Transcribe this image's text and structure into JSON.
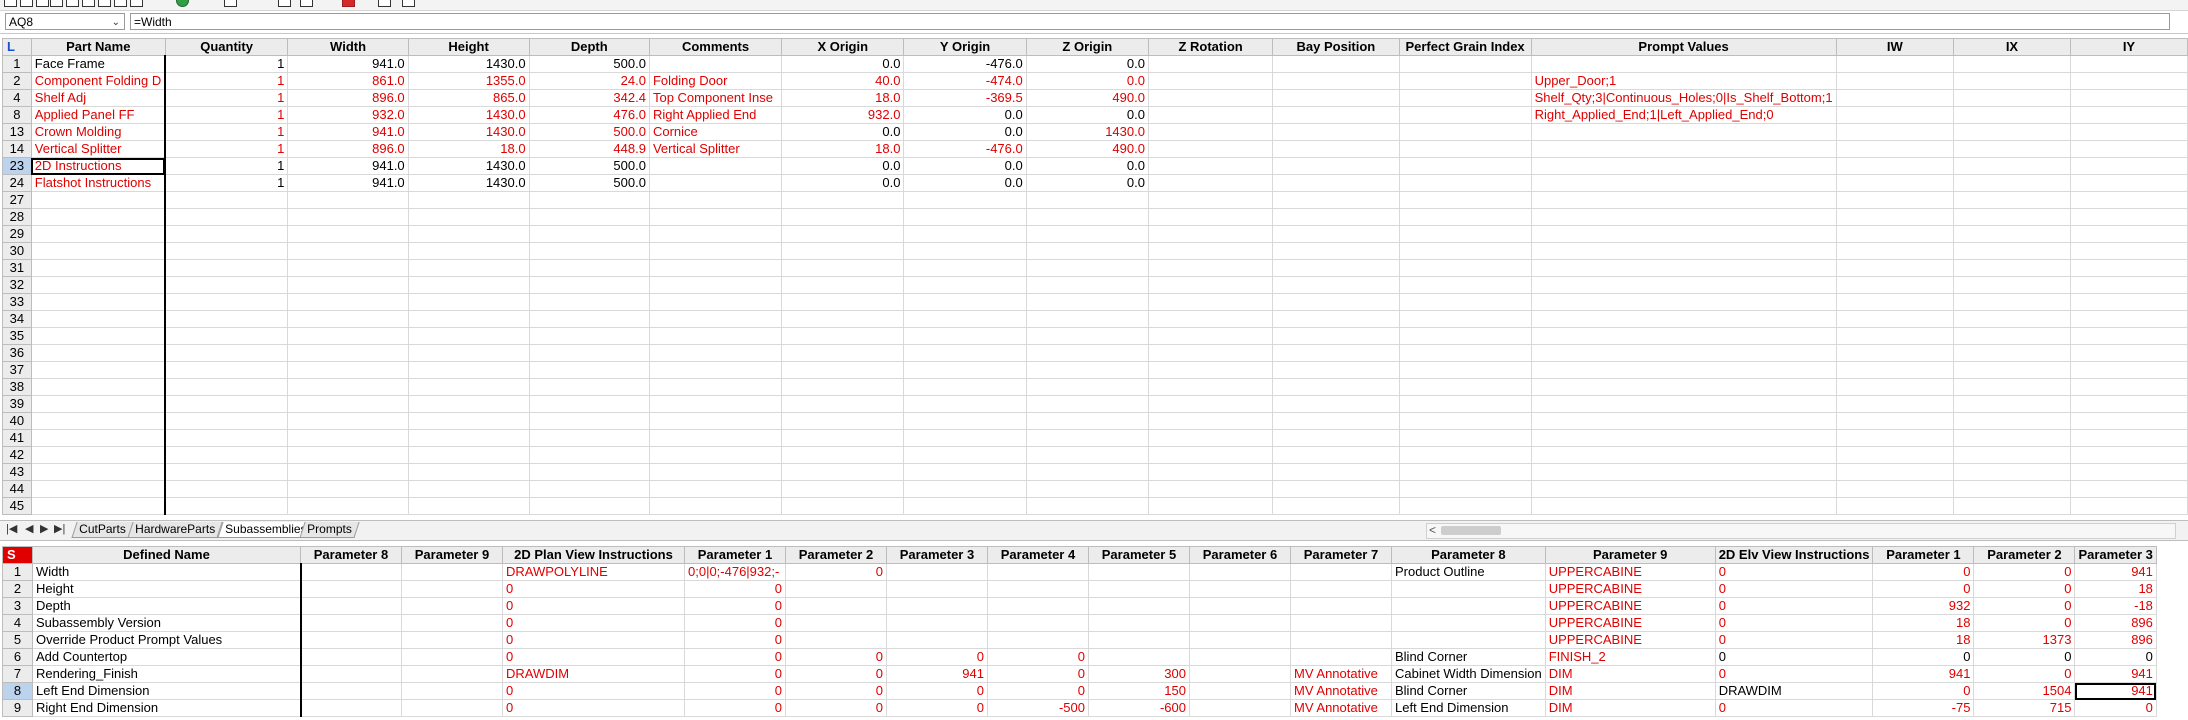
{
  "formula": {
    "cell_ref": "AQ8",
    "value": "=Width"
  },
  "top_grid": {
    "corner": "L",
    "columns": [
      "Part Name",
      "Quantity",
      "Width",
      "Height",
      "Depth",
      "Comments",
      "X Origin",
      "Y Origin",
      "Z Origin",
      "Z Rotation",
      "Bay Position",
      "Perfect Grain Index",
      "Prompt Values",
      "IW",
      "IX",
      "IY"
    ],
    "rows": [
      {
        "n": "1",
        "cells": [
          "Face Frame",
          "1",
          "941.0",
          "1430.0",
          "500.0",
          "",
          "0.0",
          "-476.0",
          "0.0",
          "",
          "",
          "",
          "",
          "",
          "",
          ""
        ]
      },
      {
        "n": "2",
        "cells": [
          "Component Folding D",
          "1",
          "861.0",
          "1355.0",
          "24.0",
          "Folding Door",
          "40.0",
          "-474.0",
          "0.0",
          "",
          "",
          "",
          "Upper_Door;1",
          "",
          "",
          ""
        ]
      },
      {
        "n": "4",
        "cells": [
          "Shelf Adj",
          "1",
          "896.0",
          "865.0",
          "342.4",
          "Top Component Inse",
          "18.0",
          "-369.5",
          "490.0",
          "",
          "",
          "",
          "Shelf_Qty;3|Continuous_Holes;0|Is_Shelf_Bottom;1",
          "",
          "",
          ""
        ]
      },
      {
        "n": "8",
        "cells": [
          "Applied Panel FF",
          "1",
          "932.0",
          "1430.0",
          "476.0",
          "Right Applied End",
          "932.0",
          "0.0",
          "0.0",
          "",
          "",
          "",
          "Right_Applied_End;1|Left_Applied_End;0",
          "",
          "",
          ""
        ]
      },
      {
        "n": "13",
        "cells": [
          "Crown Molding",
          "1",
          "941.0",
          "1430.0",
          "500.0",
          "Cornice",
          "0.0",
          "0.0",
          "1430.0",
          "",
          "",
          "",
          "",
          "",
          "",
          ""
        ]
      },
      {
        "n": "14",
        "cells": [
          "Vertical Splitter",
          "1",
          "896.0",
          "18.0",
          "448.9",
          "Vertical Splitter",
          "18.0",
          "-476.0",
          "490.0",
          "",
          "",
          "",
          "",
          "",
          "",
          ""
        ]
      },
      {
        "n": "23",
        "cells": [
          "2D Instructions",
          "1",
          "941.0",
          "1430.0",
          "500.0",
          "",
          "0.0",
          "0.0",
          "0.0",
          "",
          "",
          "",
          "",
          "",
          "",
          ""
        ]
      },
      {
        "n": "24",
        "cells": [
          "Flatshot Instructions",
          "1",
          "941.0",
          "1430.0",
          "500.0",
          "",
          "0.0",
          "0.0",
          "0.0",
          "",
          "",
          "",
          "",
          "",
          "",
          ""
        ]
      },
      {
        "n": "27",
        "cells": []
      },
      {
        "n": "28",
        "cells": []
      },
      {
        "n": "29",
        "cells": []
      },
      {
        "n": "30",
        "cells": []
      },
      {
        "n": "31",
        "cells": []
      },
      {
        "n": "32",
        "cells": []
      },
      {
        "n": "33",
        "cells": []
      },
      {
        "n": "34",
        "cells": []
      },
      {
        "n": "35",
        "cells": []
      },
      {
        "n": "36",
        "cells": []
      },
      {
        "n": "37",
        "cells": []
      },
      {
        "n": "38",
        "cells": []
      },
      {
        "n": "39",
        "cells": []
      },
      {
        "n": "40",
        "cells": []
      },
      {
        "n": "41",
        "cells": []
      },
      {
        "n": "42",
        "cells": []
      },
      {
        "n": "43",
        "cells": []
      },
      {
        "n": "44",
        "cells": []
      },
      {
        "n": "45",
        "cells": []
      }
    ],
    "selected_row": "23"
  },
  "sheet_tabs": [
    "CutParts",
    "HardwareParts",
    "Subassemblies",
    "Prompts"
  ],
  "active_tab": "Subassemblies",
  "bottom_grid": {
    "corner": "S",
    "columns": [
      "Defined Name",
      "Parameter 8",
      "Parameter 9",
      "2D Plan View Instructions",
      "Parameter 1",
      "Parameter 2",
      "Parameter 3",
      "Parameter 4",
      "Parameter 5",
      "Parameter 6",
      "Parameter 7",
      "Parameter 8",
      "Parameter 9",
      "2D Elv View Instructions",
      "Parameter 1",
      "Parameter 2",
      "Parameter 3"
    ],
    "rows": [
      {
        "n": "1",
        "cells": [
          "Width",
          "",
          "",
          "DRAWPOLYLINE",
          "0;0|0;-476|932;-",
          "0",
          "",
          "",
          "",
          "",
          "",
          "Product Outline",
          "UPPERCABINE",
          "0",
          "0",
          "0",
          "941"
        ]
      },
      {
        "n": "2",
        "cells": [
          "Height",
          "",
          "",
          "0",
          "0",
          "",
          "",
          "",
          "",
          "",
          "",
          "",
          "UPPERCABINE",
          "0",
          "0",
          "0",
          "18"
        ]
      },
      {
        "n": "3",
        "cells": [
          "Depth",
          "",
          "",
          "0",
          "0",
          "",
          "",
          "",
          "",
          "",
          "",
          "",
          "UPPERCABINE",
          "0",
          "932",
          "0",
          "-18"
        ]
      },
      {
        "n": "4",
        "cells": [
          "Subassembly Version",
          "",
          "",
          "0",
          "0",
          "",
          "",
          "",
          "",
          "",
          "",
          "",
          "UPPERCABINE",
          "0",
          "18",
          "0",
          "896"
        ]
      },
      {
        "n": "5",
        "cells": [
          "Override Product Prompt Values",
          "",
          "",
          "0",
          "0",
          "",
          "",
          "",
          "",
          "",
          "",
          "",
          "UPPERCABINE",
          "0",
          "18",
          "1373",
          "896"
        ]
      },
      {
        "n": "6",
        "cells": [
          "Add Countertop",
          "",
          "",
          "0",
          "0",
          "0",
          "0",
          "0",
          "",
          "",
          "",
          "Blind Corner",
          "FINISH_2",
          "0",
          "0",
          "0",
          "0"
        ]
      },
      {
        "n": "7",
        "cells": [
          "Rendering_Finish",
          "",
          "",
          "DRAWDIM",
          "0",
          "0",
          "941",
          "0",
          "300",
          "",
          "MV Annotative",
          "Cabinet Width Dimension",
          "DIM",
          "0",
          "941",
          "0",
          "941"
        ]
      },
      {
        "n": "8",
        "cells": [
          "Left End Dimension",
          "",
          "",
          "0",
          "0",
          "0",
          "0",
          "0",
          "150",
          "",
          "MV Annotative",
          "Blind Corner",
          "DIM",
          "DRAWDIM",
          "0",
          "1504",
          "941"
        ]
      },
      {
        "n": "9",
        "cells": [
          "Right End Dimension",
          "",
          "",
          "0",
          "0",
          "0",
          "0",
          "-500",
          "-600",
          "",
          "MV Annotative",
          "Left End Dimension",
          "DIM",
          "0",
          "-75",
          "715",
          "0"
        ]
      }
    ]
  }
}
